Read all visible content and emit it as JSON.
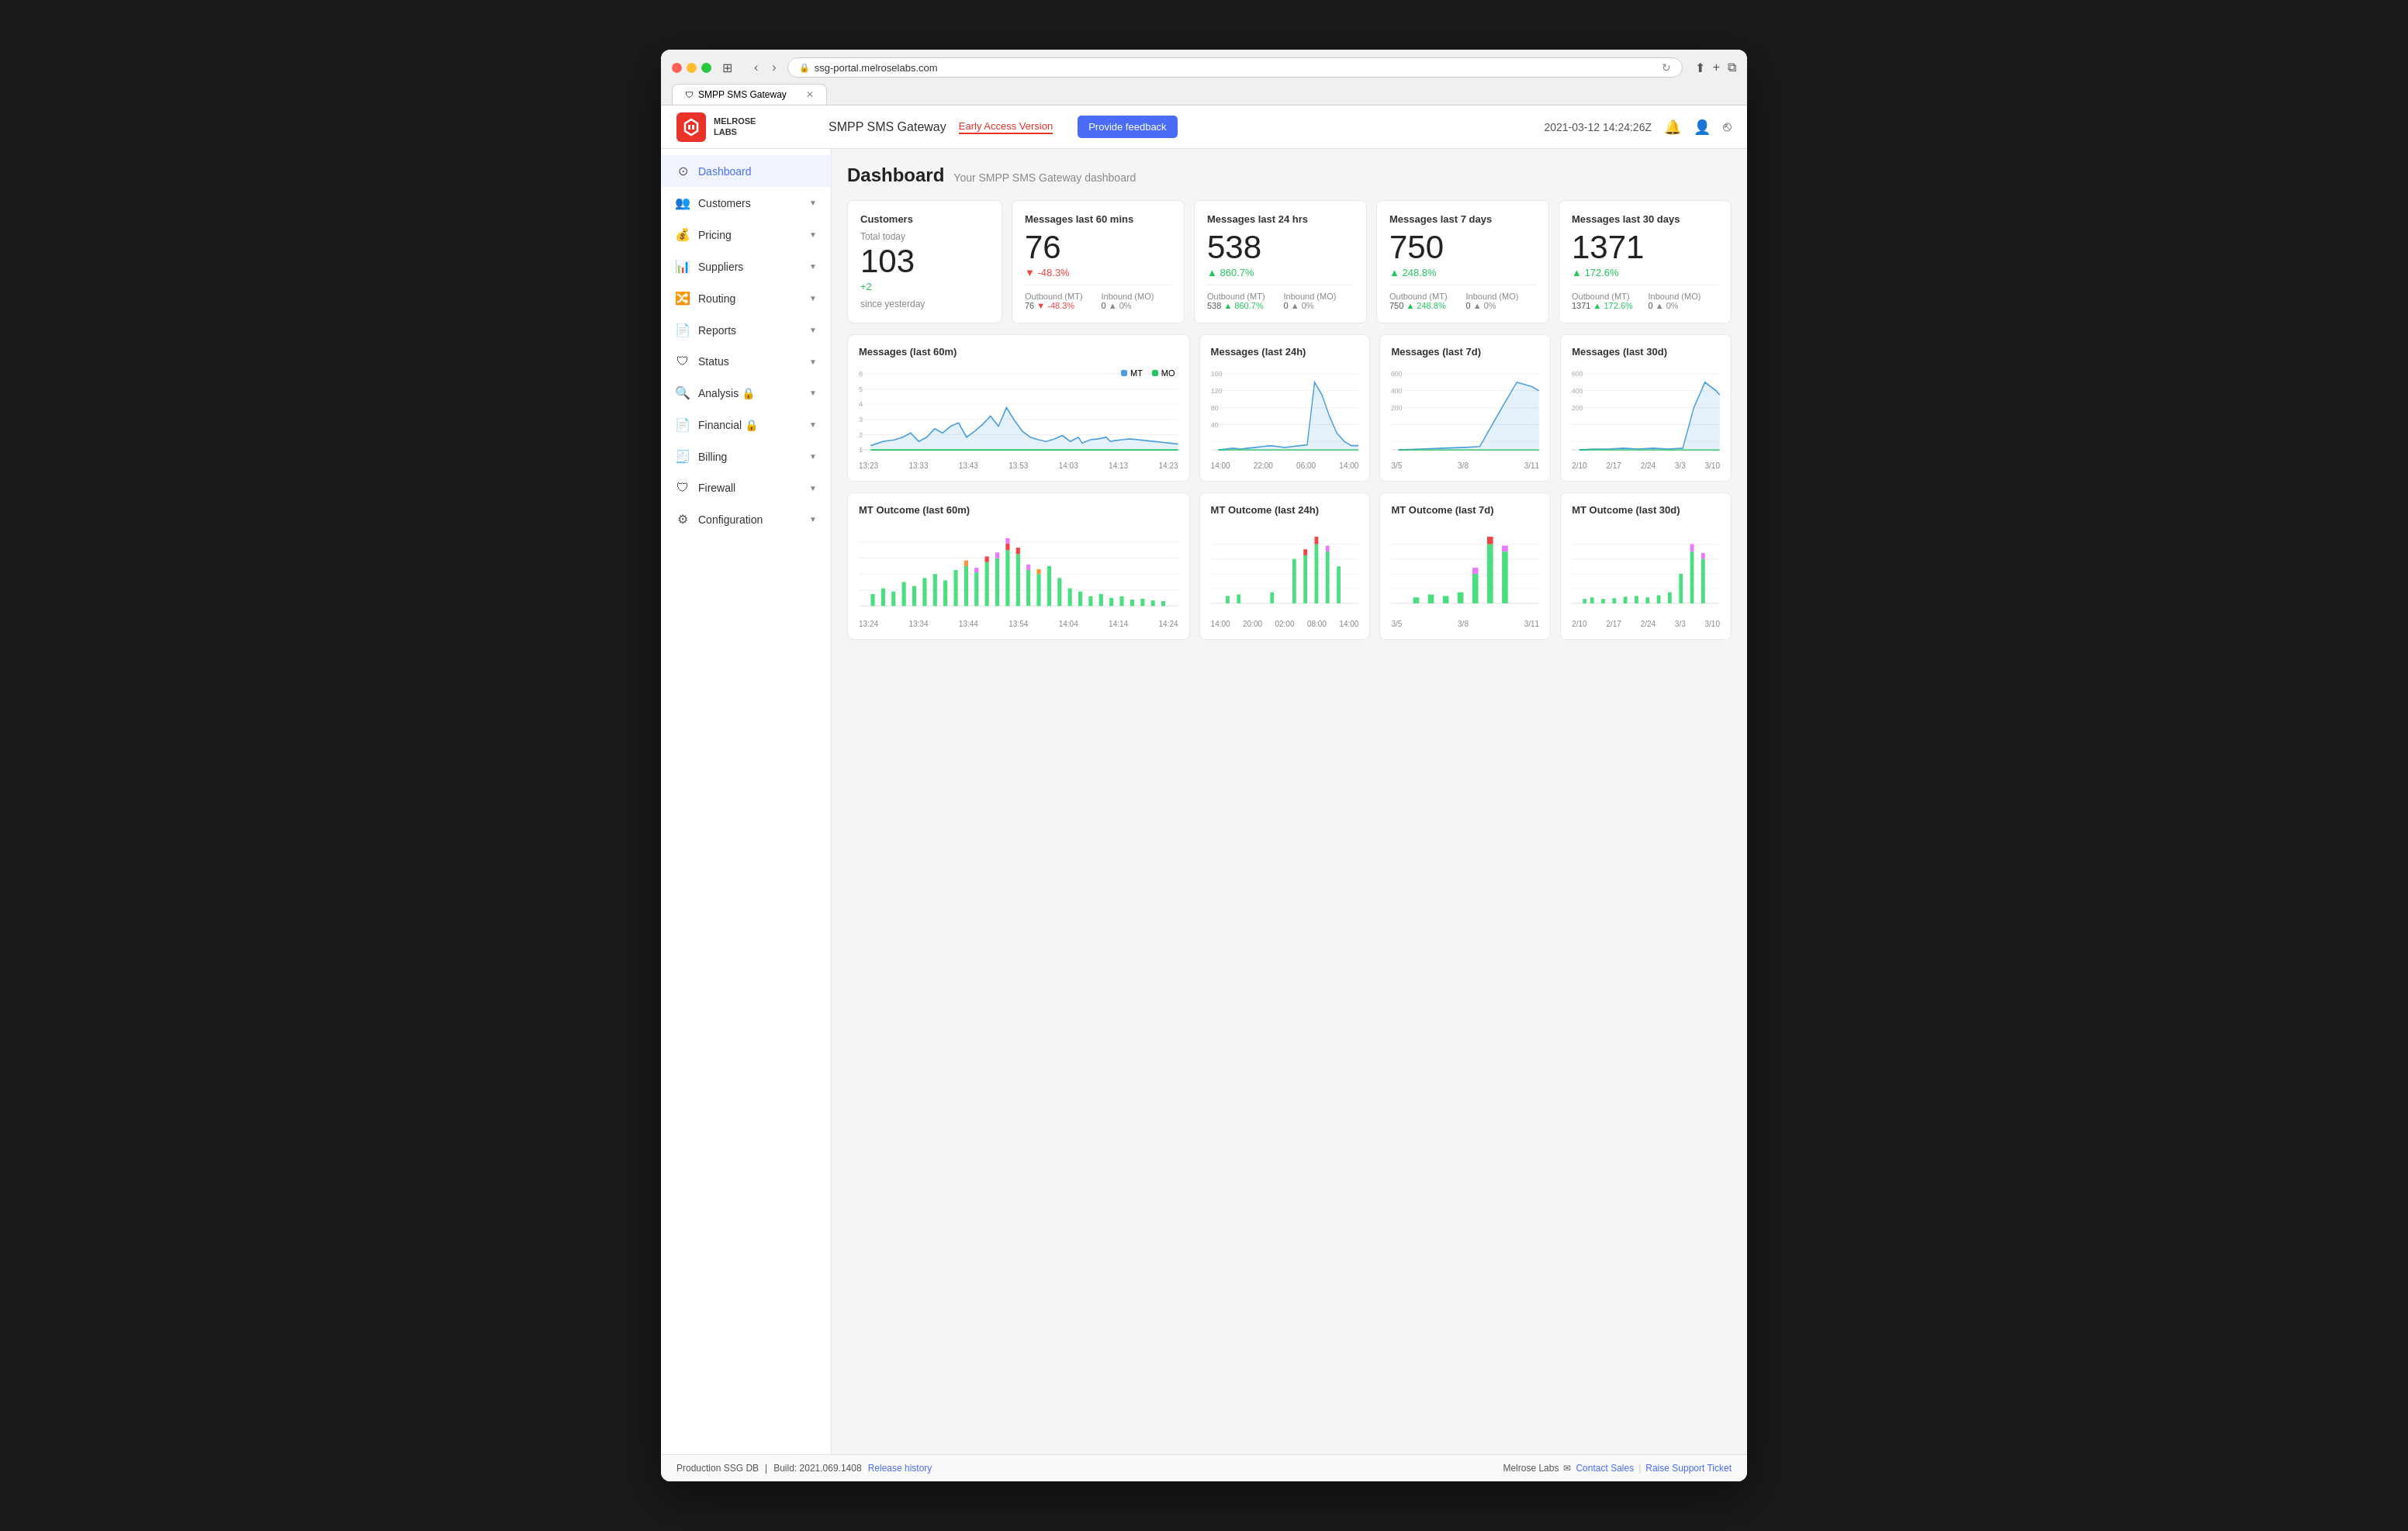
{
  "browser": {
    "url": "ssg-portal.melroselabs.com",
    "tab_title": "SMPP SMS Gateway",
    "tab_icon": "🛡"
  },
  "header": {
    "logo_text_line1": "MELROSE",
    "logo_text_line2": "LABS",
    "app_title": "SMPP SMS Gateway",
    "early_access_label": "Early Access Version",
    "feedback_label": "Provide feedback",
    "timestamp": "2021-03-12 14:24:26Z",
    "bell_icon": "🔔",
    "user_icon": "👤",
    "logout_icon": "→"
  },
  "sidebar": {
    "items": [
      {
        "id": "dashboard",
        "icon": "⊙",
        "label": "Dashboard",
        "active": true,
        "has_arrow": false
      },
      {
        "id": "customers",
        "icon": "👥",
        "label": "Customers",
        "active": false,
        "has_arrow": true
      },
      {
        "id": "pricing",
        "icon": "💰",
        "label": "Pricing",
        "active": false,
        "has_arrow": true
      },
      {
        "id": "suppliers",
        "icon": "📊",
        "label": "Suppliers",
        "active": false,
        "has_arrow": true
      },
      {
        "id": "routing",
        "icon": "🔀",
        "label": "Routing",
        "active": false,
        "has_arrow": true
      },
      {
        "id": "reports",
        "icon": "📄",
        "label": "Reports",
        "active": false,
        "has_arrow": true
      },
      {
        "id": "status",
        "icon": "🛡",
        "label": "Status",
        "active": false,
        "has_arrow": true
      },
      {
        "id": "analysis",
        "icon": "🔍",
        "label": "Analysis 🔒",
        "active": false,
        "has_arrow": true
      },
      {
        "id": "financial",
        "icon": "📄",
        "label": "Financial 🔒",
        "active": false,
        "has_arrow": true
      },
      {
        "id": "billing",
        "icon": "🧾",
        "label": "Billing",
        "active": false,
        "has_arrow": true
      },
      {
        "id": "firewall",
        "icon": "🛡",
        "label": "Firewall",
        "active": false,
        "has_arrow": true
      },
      {
        "id": "configuration",
        "icon": "⚙",
        "label": "Configuration",
        "active": false,
        "has_arrow": true
      }
    ]
  },
  "dashboard": {
    "title": "Dashboard",
    "subtitle": "Your SMPP SMS Gateway dashboard",
    "stats": [
      {
        "id": "customers",
        "title": "Customers",
        "label": "Total today",
        "value": "103",
        "change": "+2",
        "change_type": "up",
        "since": "since yesterday"
      },
      {
        "id": "msgs60",
        "title": "Messages last 60 mins",
        "value": "76",
        "change": "▼ -48.3%",
        "change_type": "down",
        "sub_mt_label": "Outbound (MT)",
        "sub_mt_value": "76",
        "sub_mt_change": "▼ -48.3%",
        "sub_mt_change_type": "down",
        "sub_mo_label": "Inbound (MO)",
        "sub_mo_value": "0",
        "sub_mo_change": "▲ 0%",
        "sub_mo_change_type": "neutral"
      },
      {
        "id": "msgs24h",
        "title": "Messages last 24 hrs",
        "value": "538",
        "change": "▲ 860.7%",
        "change_type": "up",
        "sub_mt_label": "Outbound (MT)",
        "sub_mt_value": "538",
        "sub_mt_change": "▲ 860.7%",
        "sub_mt_change_type": "up",
        "sub_mo_label": "Inbound (MO)",
        "sub_mo_value": "0",
        "sub_mo_change": "▲ 0%",
        "sub_mo_change_type": "neutral"
      },
      {
        "id": "msgs7d",
        "title": "Messages last 7 days",
        "value": "750",
        "change": "▲ 248.8%",
        "change_type": "up",
        "sub_mt_label": "Outbound (MT)",
        "sub_mt_value": "750",
        "sub_mt_change": "▲ 248.8%",
        "sub_mt_change_type": "up",
        "sub_mo_label": "Inbound (MO)",
        "sub_mo_value": "0",
        "sub_mo_change": "▲ 0%",
        "sub_mo_change_type": "neutral"
      },
      {
        "id": "msgs30d",
        "title": "Messages last 30 days",
        "value": "1371",
        "change": "▲ 172.6%",
        "change_type": "up",
        "sub_mt_label": "Outbound (MT)",
        "sub_mt_value": "1371",
        "sub_mt_change": "▲ 172.6%",
        "sub_mt_change_type": "up",
        "sub_mo_label": "Inbound (MO)",
        "sub_mo_value": "0",
        "sub_mo_change": "▲ 0%",
        "sub_mo_change_type": "neutral"
      }
    ],
    "charts_line": [
      {
        "id": "line60m",
        "title": "Messages (last 60m)",
        "x_labels": [
          "13:23",
          "13:33",
          "13:43",
          "13:53",
          "14:03",
          "14:13",
          "14:23"
        ],
        "has_legend": true,
        "colors": {
          "mt": "#4a9edd",
          "mo": "#22c55e"
        }
      },
      {
        "id": "line24h",
        "title": "Messages (last 24h)",
        "x_labels": [
          "14:00",
          "22:00",
          "06:00",
          "14:00"
        ],
        "has_legend": false,
        "colors": {
          "mt": "#4a9edd",
          "mo": "#22c55e"
        }
      },
      {
        "id": "line7d",
        "title": "Messages (last 7d)",
        "x_labels": [
          "3/5",
          "3/8",
          "3/11"
        ],
        "has_legend": false,
        "colors": {
          "mt": "#4a9edd",
          "mo": "#22c55e"
        }
      },
      {
        "id": "line30d",
        "title": "Messages (last 30d)",
        "x_labels": [
          "2/10",
          "2/17",
          "2/24",
          "3/3",
          "3/10"
        ],
        "has_legend": false,
        "colors": {
          "mt": "#4a9edd",
          "mo": "#22c55e"
        }
      }
    ],
    "charts_outcome": [
      {
        "id": "out60m",
        "title": "MT Outcome (last 60m)",
        "x_labels": [
          "13:24",
          "13:34",
          "13:44",
          "13:54",
          "14:04",
          "14:14",
          "14:24"
        ]
      },
      {
        "id": "out24h",
        "title": "MT Outcome (last 24h)",
        "x_labels": [
          "14:00",
          "20:00",
          "02:00",
          "08:00",
          "14:00"
        ]
      },
      {
        "id": "out7d",
        "title": "MT Outcome (last 7d)",
        "x_labels": [
          "3/5",
          "3/8",
          "3/11"
        ]
      },
      {
        "id": "out30d",
        "title": "MT Outcome (last 30d)",
        "x_labels": [
          "2/10",
          "2/17",
          "2/24",
          "3/3",
          "3/10"
        ]
      }
    ]
  },
  "footer": {
    "db_label": "Production SSG DB",
    "build_label": "Build: 2021.069.1408",
    "release_history_label": "Release history",
    "company": "Melrose Labs",
    "contact_sales": "Contact Sales",
    "support_ticket": "Raise Support Ticket"
  }
}
